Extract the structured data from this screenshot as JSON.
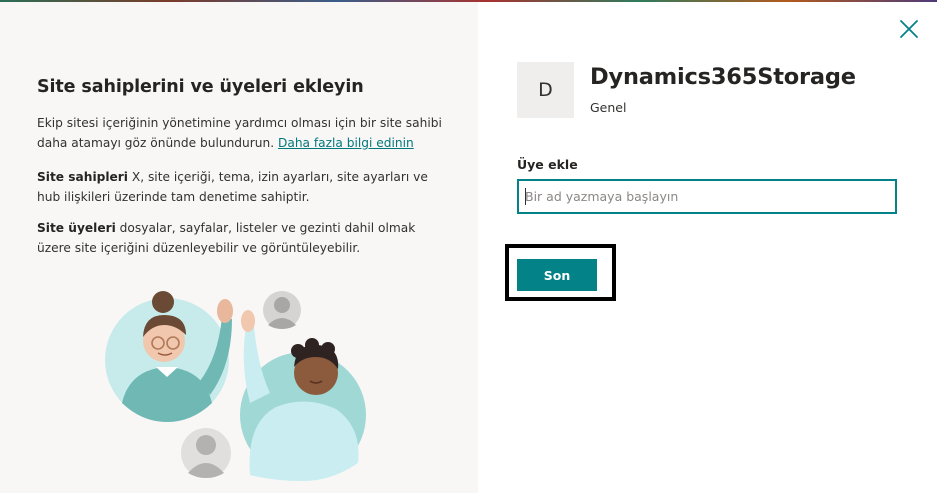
{
  "left_panel": {
    "title": "Site sahiplerini ve üyeleri ekleyin",
    "intro_text": "Ekip sitesi içeriğinin yönetimine yardımcı olması için bir site sahibi daha atamayı göz önünde bulundurun.",
    "learn_more_link": "Daha fazla bilgi edinin",
    "owners_heading": "Site sahipleri",
    "owners_text": " X, site içeriği, tema, izin ayarları, site ayarları ve hub ilişkileri üzerinde tam denetime sahiptir.",
    "members_heading": "Site üyeleri",
    "members_text": " dosyalar, sayfalar, listeler ve gezinti dahil olmak üzere site içeriğini düzenleyebilir ve görüntüleyebilir."
  },
  "site": {
    "initial": "D",
    "name": "Dynamics365Storage",
    "subtitle": "Genel"
  },
  "form": {
    "add_member_label": "Üye ekle",
    "input_value": "",
    "input_placeholder": "Bir ad yazmaya başlayın"
  },
  "actions": {
    "done_label": "Son"
  },
  "icons": {
    "close": "close-icon",
    "illustration": "collaboration-illustration"
  },
  "colors": {
    "accent": "#038387",
    "link": "#03787c",
    "left_background": "#f8f7f6",
    "focus_outline": "#000000"
  }
}
